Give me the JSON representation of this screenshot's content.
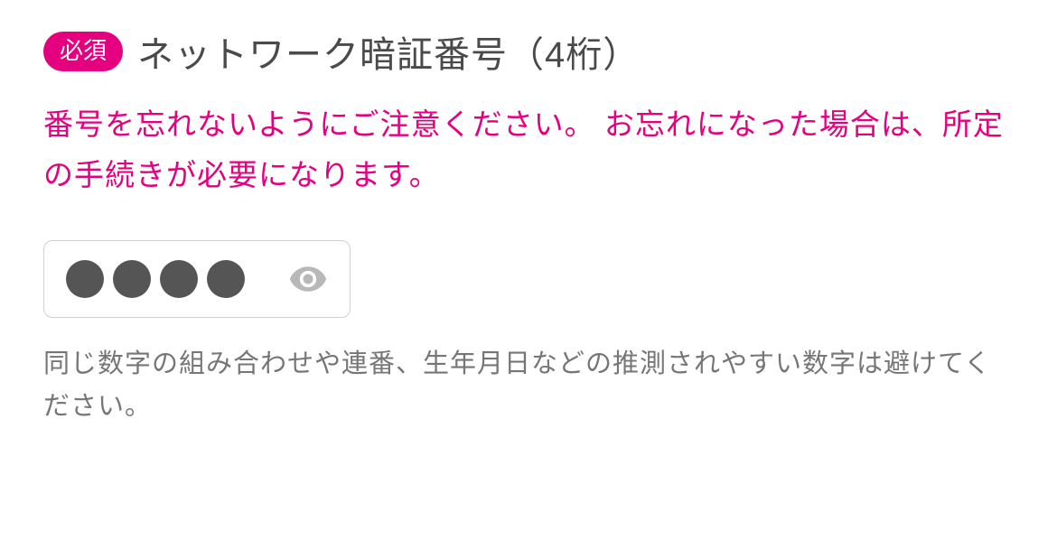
{
  "badge": {
    "text": "必須"
  },
  "title": "ネットワーク暗証番号（4桁）",
  "warning": "番号を忘れないようにご注意ください。 お忘れになった場合は、所定の手続きが必要になります。",
  "pin": {
    "digits_entered": 4,
    "max_digits": 4
  },
  "hint": "同じ数字の組み合わせや連番、生年月日などの推測されやすい数字は避けてください。",
  "icons": {
    "eye": "eye-icon"
  }
}
